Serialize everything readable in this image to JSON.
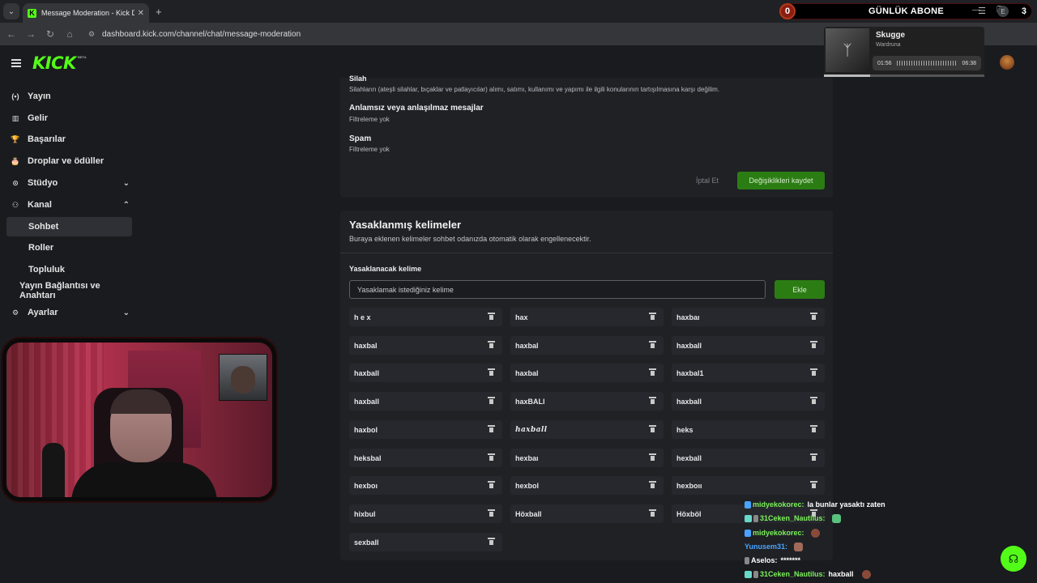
{
  "browser": {
    "tab_title": "Message Moderation - Kick Das",
    "url": "dashboard.kick.com/channel/chat/message-moderation"
  },
  "overlay": {
    "abone_left": "0",
    "abone_title": "GÜNLÜK ABONE",
    "abone_right": "3"
  },
  "spotify": {
    "song": "Skugge",
    "artist": "Wardruna",
    "elapsed": "01:56",
    "duration": "06:38",
    "progress": 0.29
  },
  "brand": {
    "logo": "KICK",
    "beta": "BETA",
    "accent": "#53fc18"
  },
  "sidebar": {
    "items": [
      {
        "icon": "(•)",
        "label": "Yayın"
      },
      {
        "icon": "▥",
        "label": "Gelir"
      },
      {
        "icon": "🏆",
        "label": "Başarılar"
      },
      {
        "icon": "🎂",
        "label": "Droplar ve ödüller"
      },
      {
        "icon": "⊙",
        "label": "Stüdyo"
      },
      {
        "icon": "⚇",
        "label": "Kanal"
      },
      {
        "label": "Sohbet"
      },
      {
        "label": "Roller"
      },
      {
        "label": "Topluluk"
      },
      {
        "label": "Yayın Bağlantısı ve Anahtarı"
      },
      {
        "icon": "⚙",
        "label": "Ayarlar"
      }
    ]
  },
  "filters": {
    "cut_title": "Silah",
    "cut_desc": "Silahların (ateşli silahlar, bıçaklar ve patlayıcılar) alımı, satımı, kullanımı ve yapımı ile ilgili konularının tartışılmasına karşı değilim.",
    "nonsense_title": "Anlamsız veya anlaşılmaz mesajlar",
    "nonsense_desc": "Filtreleme yok",
    "spam_title": "Spam",
    "spam_desc": "Filtreleme yok",
    "cancel_label": "İptal Et",
    "save_label": "Değişiklikleri kaydet"
  },
  "banned": {
    "title": "Yasaklanmış kelimeler",
    "description": "Buraya eklenen kelimeler sohbet odanızda otomatik olarak engellenecektir.",
    "field_label": "Yasaklanacak kelime",
    "placeholder": "Yasaklamak istediğiniz kelime",
    "add_label": "Ekle",
    "words": [
      "h e x",
      "hax",
      "haxbaı",
      "haxbal",
      "haxbal",
      "haxball",
      "haxball",
      "haxbal",
      "haxbal1",
      "haxball",
      "haxBALl",
      "haxball",
      "haxbol",
      "𝒉𝒂𝒙𝒃𝒂𝒍𝒍",
      "heks",
      "heksbal",
      "hexbaı",
      "hexball",
      "hexboı",
      "hexbol",
      "hexboıı",
      "hixbul",
      "Höxball",
      "Höxböl",
      "sexball"
    ]
  },
  "chat": [
    {
      "user": "midyekokorec:",
      "msg": "la bunlar yasaktı zaten",
      "color": "#7cf25a"
    },
    {
      "user": "31Ceken_Nautilus:",
      "msg": "",
      "color": "#7cf25a"
    },
    {
      "user": "midyekokorec:",
      "msg": "",
      "color": "#7cf25a"
    },
    {
      "user": "Yunusem31:",
      "msg": "",
      "color": "#4aa3ff"
    },
    {
      "user": "Aselos:",
      "msg": "*******",
      "color": "#ffffff"
    },
    {
      "user": "31Ceken_Nautilus:",
      "msg": "haxball",
      "color": "#7cf25a"
    }
  ]
}
